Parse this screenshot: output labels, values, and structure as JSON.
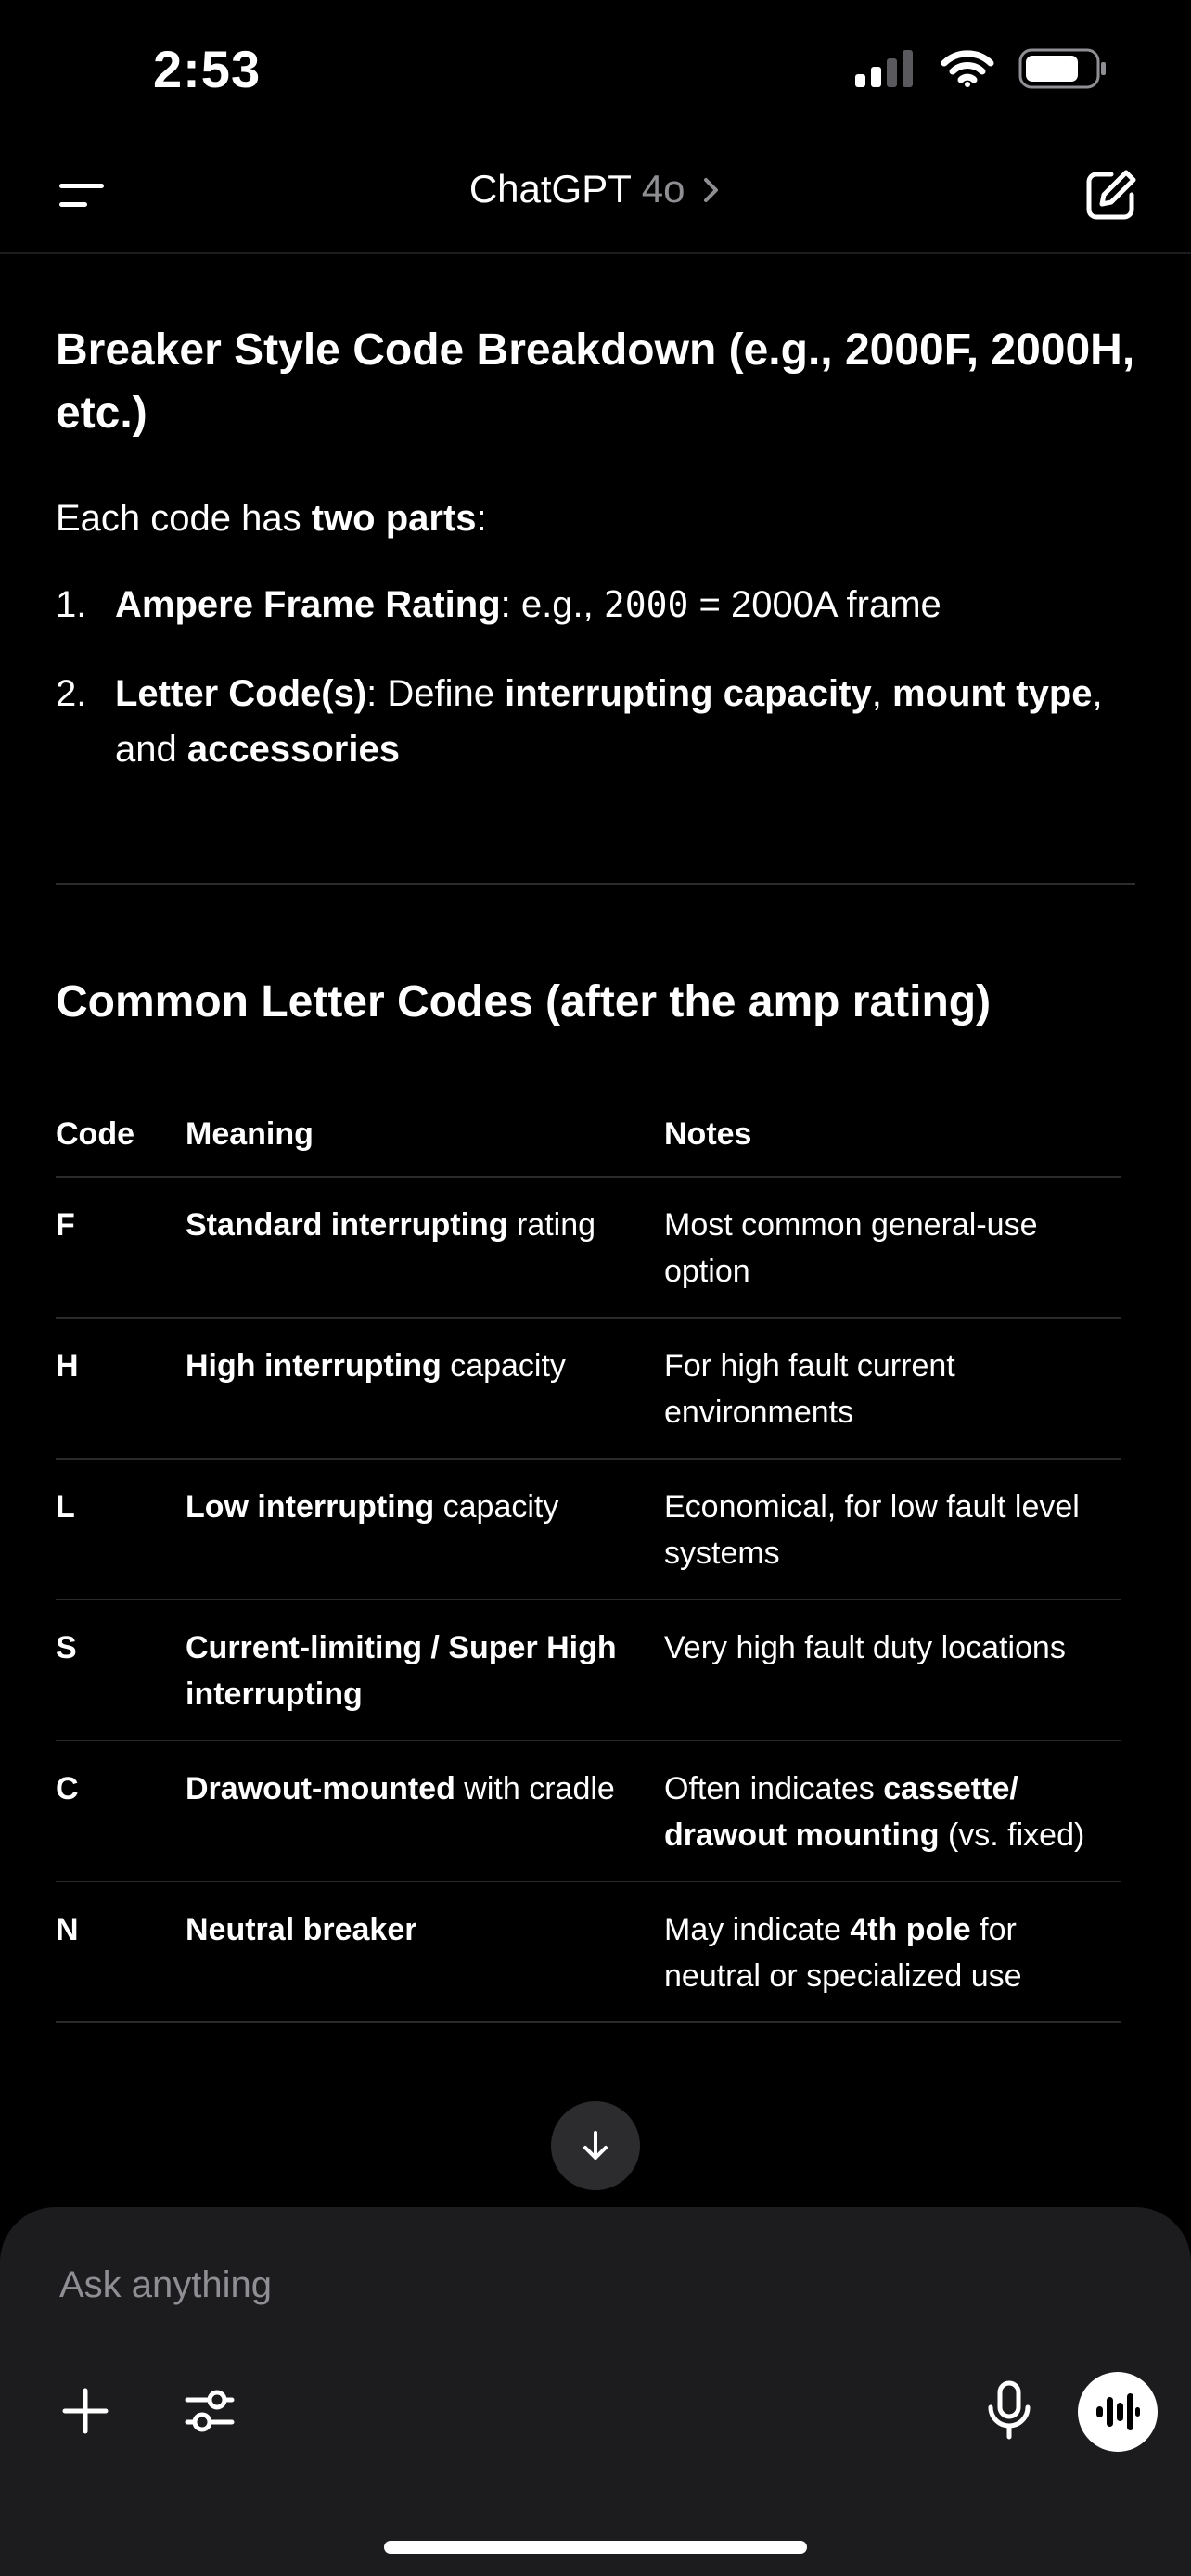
{
  "status_bar": {
    "time": "2:53"
  },
  "nav": {
    "title": "ChatGPT",
    "model": "4o",
    "chevron": ">"
  },
  "message": {
    "heading": "Breaker Style Code Breakdown (e.g., 2000F, 2000H, etc.)",
    "intro": {
      "prefix": "Each code has ",
      "bold": "two parts",
      "suffix": ":"
    },
    "list": [
      {
        "num": "1.",
        "bold": "Ampere Frame Rating",
        "text1": ": e.g., ",
        "code": "2000",
        "text2": " = 2000A frame"
      },
      {
        "num": "2.",
        "bold": "Letter Code(s)",
        "text1": ": Define ",
        "b2": "interrupting capacity",
        "t2": ", ",
        "b3": "mount type",
        "t3": ", and ",
        "b4": "accessories"
      }
    ],
    "section_heading": "Common Letter Codes (after the amp rating)",
    "table": {
      "headers": [
        "Code",
        "Meaning",
        "Notes"
      ],
      "rows": [
        {
          "code": "F",
          "meaning_bold": "Standard interrupting",
          "meaning_rest": " rating",
          "notes": "Most common general-use option"
        },
        {
          "code": "H",
          "meaning_bold": "High interrupting",
          "meaning_rest": " capacity",
          "notes": "For high fault current environments"
        },
        {
          "code": "L",
          "meaning_bold": "Low interrupting",
          "meaning_rest": " capacity",
          "notes": "Economical, for low fault level systems"
        },
        {
          "code": "S",
          "meaning_bold": "Current-limiting / Super High interrupting",
          "meaning_rest": "",
          "notes": "Very high fault duty locations"
        },
        {
          "code": "C",
          "meaning_bold": "Drawout-mounted",
          "meaning_rest": " with cradle",
          "notes_pre": "Often indicates ",
          "notes_bold": "cassette/ drawout mounting",
          "notes_post": " (vs. fixed)"
        },
        {
          "code": "N",
          "meaning_bold": "Neutral breaker",
          "meaning_rest": "",
          "notes_pre": "May indicate ",
          "notes_bold": "4th pole",
          "notes_post": " for neutral or specialized use"
        }
      ]
    }
  },
  "composer": {
    "placeholder": "Ask anything"
  },
  "icons": {
    "menu": "menu-icon",
    "edit": "new-chat-icon",
    "scroll": "arrow-down-icon",
    "plus": "plus-icon",
    "tools": "sliders-icon",
    "mic": "microphone-icon",
    "voice": "voice-mode-icon"
  }
}
